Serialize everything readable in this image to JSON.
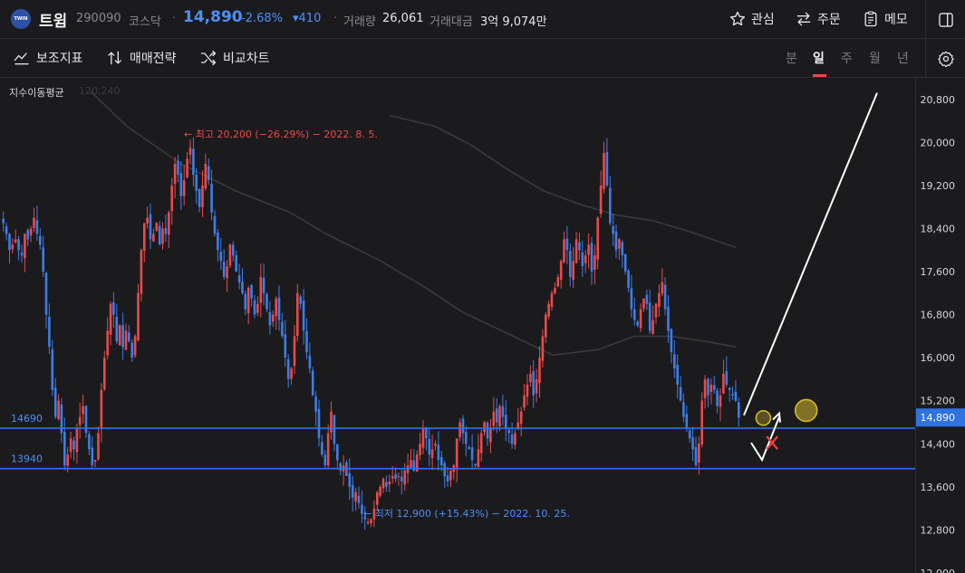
{
  "header": {
    "logo_text": "TWIN",
    "stock_name": "트윔",
    "code": "290090",
    "market": "코스닥",
    "price": "14,890",
    "change_rate": "-2.68%",
    "change_amount": "▾410",
    "volume_label": "거래량",
    "volume": "26,061",
    "amount_label": "거래대금",
    "amount": "3억 9,074만",
    "buttons": {
      "watch": "관심",
      "order": "주문",
      "memo": "메모"
    }
  },
  "toolbar": {
    "indicator": "보조지표",
    "strategy": "매매전략",
    "compare": "비교차트",
    "periods": [
      "분",
      "일",
      "주",
      "월",
      "년"
    ],
    "active_period": "일"
  },
  "colors": {
    "up": "#e84a4a",
    "down": "#3d7de6",
    "hline": "#2f72e0",
    "price_tag": "#2f72e0",
    "ma": "#3a3a3e",
    "annotation_yellow": "#d4b82a",
    "annotation_white": "#ffffff",
    "annotation_red": "#ff3b3b"
  },
  "chart_data": {
    "type": "candlestick",
    "indicator_label": "지수이동평균",
    "indicator_value": "120,240",
    "y_ticks": [
      "20,800",
      "20,000",
      "19,200",
      "18,400",
      "17,600",
      "16,800",
      "16,000",
      "15,200",
      "14,400",
      "13,600",
      "12,800",
      "12,000"
    ],
    "ylim": [
      12000,
      21200
    ],
    "current_price": {
      "value": 14890,
      "label": "14,890"
    },
    "horizontal_lines": [
      {
        "value": 14690,
        "label": "14690"
      },
      {
        "value": 13940,
        "label": "13940"
      }
    ],
    "max_annotation": {
      "value": 20200,
      "text": "← 최고 20,200 (−26.29%) − 2022. 8. 5."
    },
    "min_annotation": {
      "value": 12900,
      "text": "← 최저 12,900 (+15.43%) − 2022. 10. 25."
    },
    "closes": [
      18500,
      18300,
      18000,
      18100,
      18200,
      18000,
      17900,
      18300,
      18200,
      18400,
      18600,
      18300,
      18100,
      17600,
      16800,
      16200,
      15400,
      14900,
      15200,
      14600,
      14000,
      14200,
      14500,
      14300,
      14700,
      14900,
      15100,
      14600,
      14300,
      14000,
      14100,
      14600,
      15400,
      16000,
      16500,
      17000,
      16800,
      16300,
      16600,
      16200,
      16500,
      16300,
      16000,
      16400,
      17200,
      18000,
      18500,
      18600,
      18200,
      18300,
      18500,
      18100,
      18400,
      18300,
      18700,
      19200,
      19600,
      19400,
      19000,
      19300,
      19700,
      19900,
      19400,
      19100,
      18800,
      19200,
      19600,
      19300,
      18700,
      18300,
      18000,
      17800,
      17500,
      17700,
      18100,
      17900,
      17600,
      17400,
      17200,
      16900,
      17300,
      17100,
      16800,
      17000,
      17500,
      17200,
      16900,
      16600,
      16800,
      17100,
      16700,
      16400,
      16000,
      15600,
      15800,
      16400,
      17200,
      17000,
      16500,
      16100,
      15800,
      15300,
      15000,
      14500,
      14200,
      14000,
      14600,
      15000,
      14400,
      14100,
      13900,
      14000,
      13800,
      13600,
      13400,
      13500,
      13300,
      13100,
      13000,
      12950,
      13000,
      13200,
      13500,
      13600,
      13750,
      13600,
      13700,
      13800,
      13750,
      13800,
      13700,
      13900,
      14000,
      14100,
      13900,
      14200,
      14400,
      14700,
      14500,
      14200,
      14300,
      14400,
      14100,
      14000,
      13800,
      13700,
      13900,
      14000,
      14500,
      14800,
      14600,
      14400,
      14300,
      14100,
      14000,
      14300,
      14600,
      14800,
      14500,
      14700,
      15000,
      14800,
      15100,
      14900,
      14700,
      14600,
      14400,
      14600,
      14800,
      15000,
      15300,
      15500,
      15700,
      15300,
      15600,
      16000,
      16400,
      16800,
      17000,
      17200,
      17300,
      17500,
      17800,
      18200,
      18000,
      17500,
      17800,
      18200,
      18000,
      17700,
      17900,
      18100,
      17600,
      17900,
      18600,
      19200,
      19800,
      19200,
      18500,
      18300,
      18000,
      18200,
      17900,
      17600,
      17300,
      16900,
      16700,
      16600,
      16900,
      17100,
      17000,
      16500,
      16700,
      17000,
      17200,
      17400,
      16900,
      16500,
      16100,
      15800,
      15500,
      15200,
      14900,
      14700,
      14500,
      14300,
      14000,
      14400,
      15200,
      15600,
      15300,
      15500,
      15400,
      15100,
      15300,
      15700,
      15500,
      15400,
      15300,
      15200,
      14890
    ],
    "ema": [
      {
        "name": "ema-long",
        "values": [
          [
            100,
            20950
          ],
          [
            140,
            20300
          ],
          [
            200,
            19600
          ],
          [
            260,
            19100
          ],
          [
            320,
            18700
          ],
          [
            360,
            18300
          ],
          [
            420,
            17800
          ],
          [
            470,
            17300
          ],
          [
            510,
            16850
          ],
          [
            560,
            16450
          ],
          [
            610,
            16050
          ],
          [
            660,
            16150
          ],
          [
            700,
            16400
          ],
          [
            740,
            16400
          ],
          [
            780,
            16300
          ],
          [
            812,
            16200
          ]
        ]
      },
      {
        "name": "ema-short",
        "values": [
          [
            430,
            20500
          ],
          [
            480,
            20300
          ],
          [
            520,
            19950
          ],
          [
            560,
            19500
          ],
          [
            600,
            19100
          ],
          [
            640,
            18850
          ],
          [
            680,
            18650
          ],
          [
            720,
            18550
          ],
          [
            760,
            18350
          ],
          [
            812,
            18050
          ]
        ]
      }
    ]
  },
  "trade_annotation": {
    "entry_circle": {
      "x_index": 248,
      "value": 14880
    },
    "x_mark": {
      "x_index": 252,
      "value": 14420
    },
    "path": [
      [
        829,
        14420
      ],
      [
        841,
        14100
      ],
      [
        860,
        14900
      ]
    ],
    "target_circle": {
      "x_index": 262,
      "value": 15020
    },
    "trend_arrow": [
      [
        821,
        14930
      ],
      [
        968,
        20920
      ]
    ]
  }
}
